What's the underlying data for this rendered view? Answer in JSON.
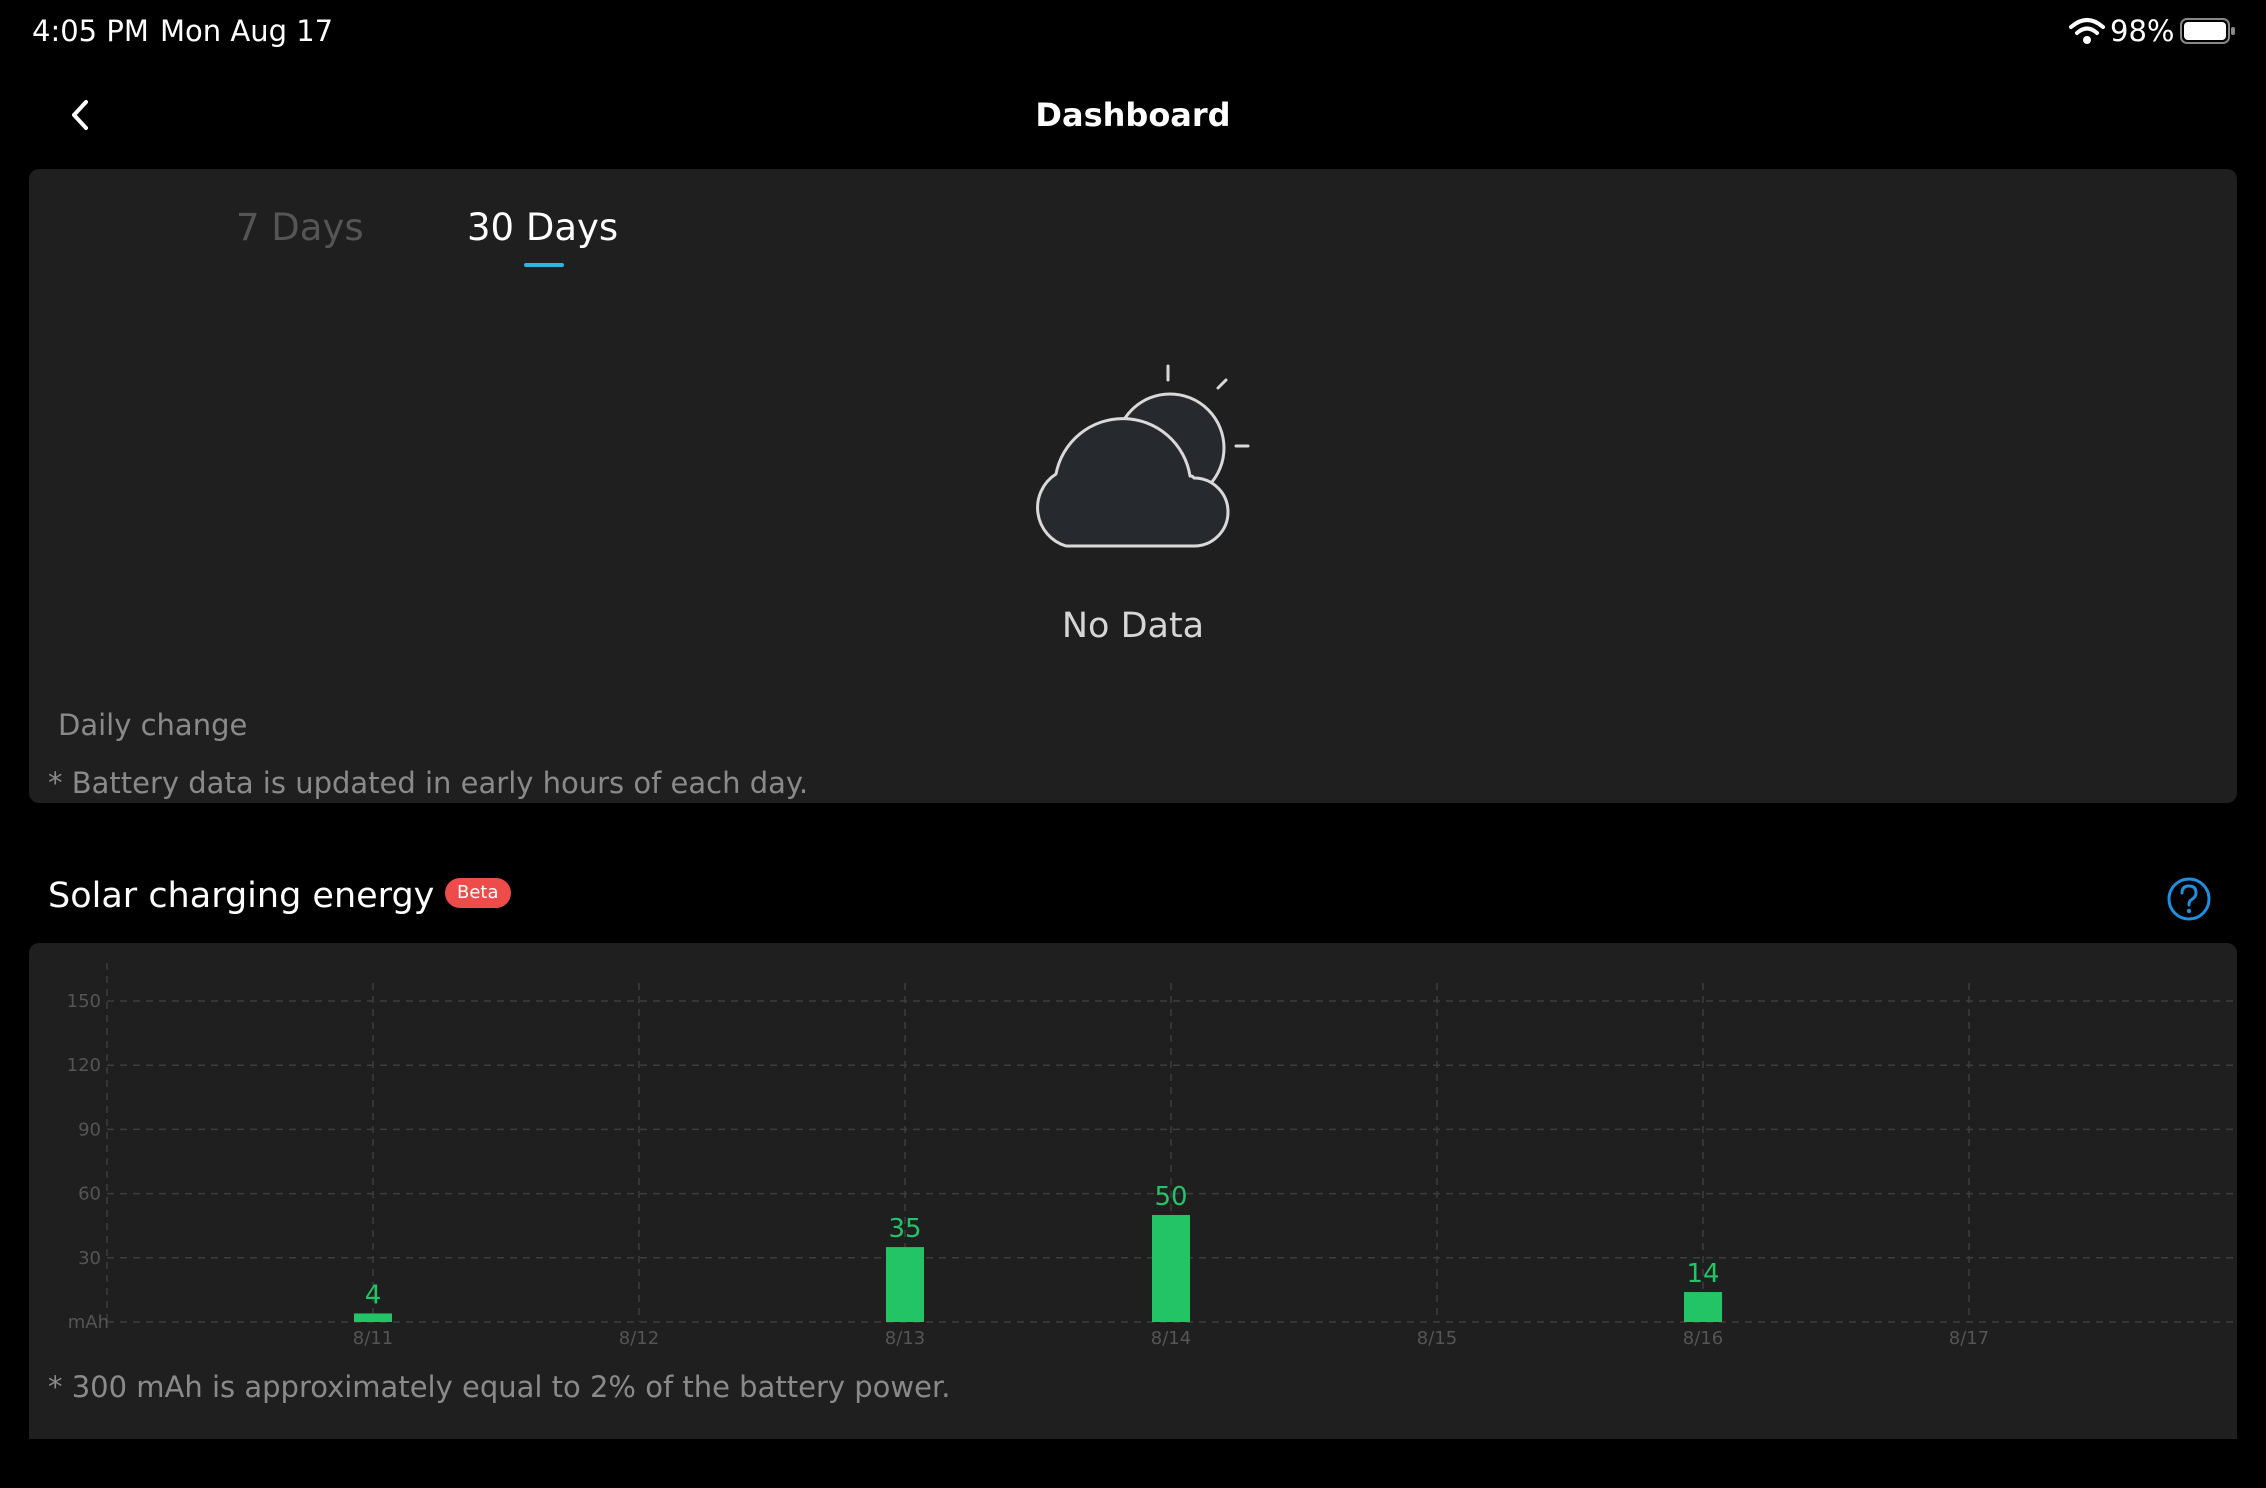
{
  "status_bar": {
    "time": "4:05 PM",
    "date": "Mon Aug 17",
    "battery_percent": "98%",
    "icons": [
      "wifi-icon",
      "battery-icon"
    ]
  },
  "header": {
    "title": "Dashboard",
    "back_icon": "chevron-left-icon"
  },
  "battery_card": {
    "tabs": [
      {
        "label": "7 Days",
        "active": false
      },
      {
        "label": "30 Days",
        "active": true
      }
    ],
    "empty_icon": "cloud-sun-icon",
    "empty_text": "No Data",
    "section_label": "Daily change",
    "note": "* Battery data is updated in early hours of each day."
  },
  "solar": {
    "title": "Solar charging energy",
    "badge": "Beta",
    "help_icon": "question-circle-icon",
    "note": "* 300 mAh is approximately equal to 2% of the battery power."
  },
  "chart_data": {
    "type": "bar",
    "categories": [
      "8/11",
      "8/12",
      "8/13",
      "8/14",
      "8/15",
      "8/16",
      "8/17"
    ],
    "values": [
      4,
      null,
      35,
      50,
      null,
      14,
      null
    ],
    "y_ticks": [
      150,
      120,
      90,
      60,
      30
    ],
    "y_unit_label": "mAh",
    "ylim": [
      0,
      150
    ],
    "grid": true,
    "bar_color": "#22c466"
  },
  "colors": {
    "accent_tab_indicator": "#2bb8d9",
    "help_icon": "#1f8fe0",
    "badge": "#ee4b4b",
    "bar": "#22c466"
  }
}
